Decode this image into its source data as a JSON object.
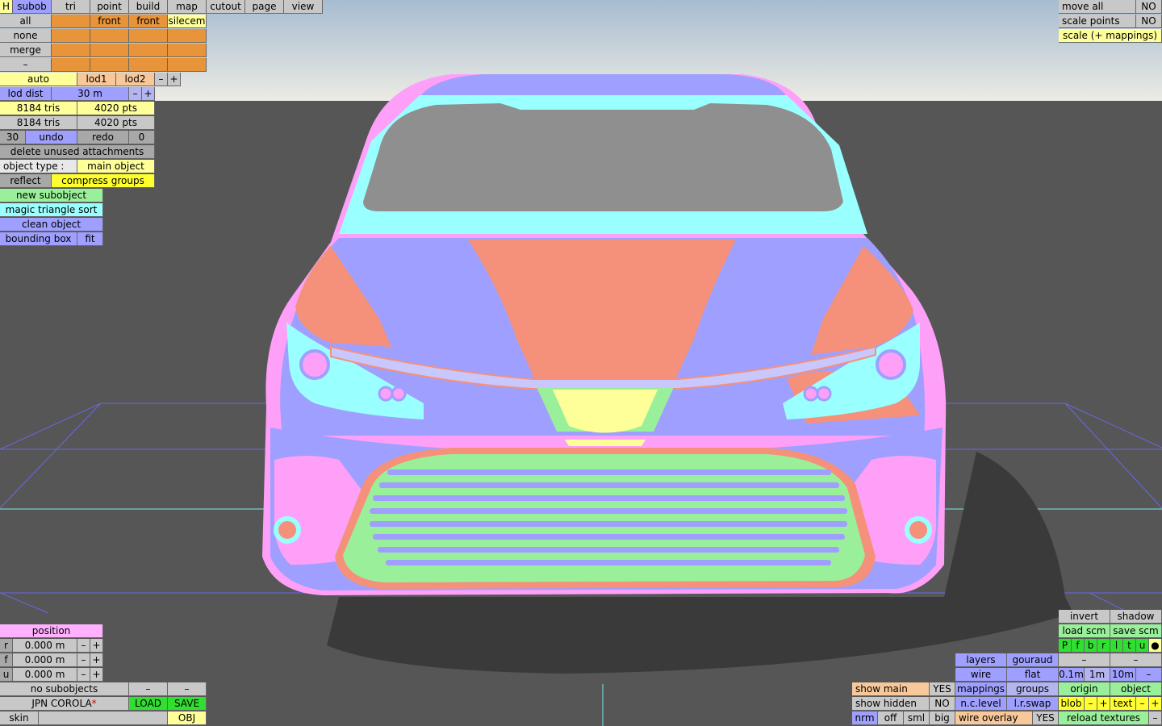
{
  "top_tabs": [
    "H",
    "subob",
    "tri",
    "point",
    "build",
    "map",
    "cutout",
    "page",
    "view"
  ],
  "top_right": {
    "move_all": "move all",
    "move_all_val": "NO",
    "scale_points": "scale points",
    "scale_points_val": "NO",
    "scale_mappings": "scale (+ mappings)"
  },
  "subob_panel": {
    "all": "all",
    "none": "none",
    "merge": "merge",
    "minus": "–",
    "front1": "front",
    "front2": "front",
    "silecem": "silecem"
  },
  "lod": {
    "auto": "auto",
    "lod1": "lod1",
    "lod2": "lod2",
    "minus": "–",
    "plus": "+",
    "lod_dist": "lod dist",
    "lod_dist_val": "30 m"
  },
  "stats": {
    "tris1": "8184 tris",
    "pts1": "4020 pts",
    "tris2": "8184 tris",
    "pts2": "4020 pts",
    "undo_count": "30",
    "undo": "undo",
    "redo": "redo",
    "redo_count": "0"
  },
  "actions": {
    "delete_unused": "delete unused attachments",
    "object_type_label": "object type :",
    "object_type_val": "main object",
    "reflect": "reflect",
    "compress_groups": "compress groups",
    "new_subobject": "new subobject",
    "magic_sort": "magic triangle sort",
    "clean_object": "clean object",
    "bounding_box": "bounding box",
    "fit": "fit"
  },
  "position_panel": {
    "title": "position",
    "rows": [
      {
        "axis": "r",
        "value": "0.000 m"
      },
      {
        "axis": "f",
        "value": "0.000 m"
      },
      {
        "axis": "u",
        "value": "0.000 m"
      }
    ],
    "minus": "–",
    "plus": "+"
  },
  "bottom_left": {
    "no_subobjects": "no subobjects",
    "minus": "–",
    "filename": "JPN COROLA",
    "modified_mark": "*",
    "load": "LOAD",
    "save": "SAVE",
    "skin": "skin",
    "obj": "OBJ"
  },
  "bottom_right": {
    "invert": "invert",
    "shadow": "shadow",
    "load_scm": "load scm",
    "save_scm": "save scm",
    "pfbrltu": [
      "P",
      "f",
      "b",
      "r",
      "l",
      "t",
      "u",
      "●"
    ],
    "minus": "–",
    "plus": "+",
    "layers": "layers",
    "gouraud": "gouraud",
    "wire": "wire",
    "flat": "flat",
    "step1": "0.1m",
    "step2": "1m",
    "step3": "10m",
    "mappings": "mappings",
    "groups": "groups",
    "origin": "origin",
    "object": "object",
    "lr_swap": "l.r.swap",
    "nc_level": "n.c.level",
    "blob": "blob",
    "text": "text",
    "show_main": "show main",
    "show_main_val": "YES",
    "show_hidden": "show hidden",
    "show_hidden_val": "NO",
    "nrm": "nrm",
    "off": "off",
    "sml": "sml",
    "big": "big",
    "wire_overlay": "wire overlay",
    "wire_overlay_val": "YES",
    "reload_textures": "reload textures"
  },
  "colors": {
    "sky_top": "#a8bed0",
    "sky_bottom": "#e8e8e2",
    "ground": "#555555",
    "body_blue": "#9f9fff",
    "body_salmon": "#f5917a",
    "body_pink": "#ffa0f8",
    "body_cyan": "#9affff",
    "glass": "#8f8f8f",
    "grille_green": "#9af09a",
    "emblem_yellow": "#ffff9a",
    "shadow": "#3a3a3a",
    "grid_line": "#6464e0"
  }
}
